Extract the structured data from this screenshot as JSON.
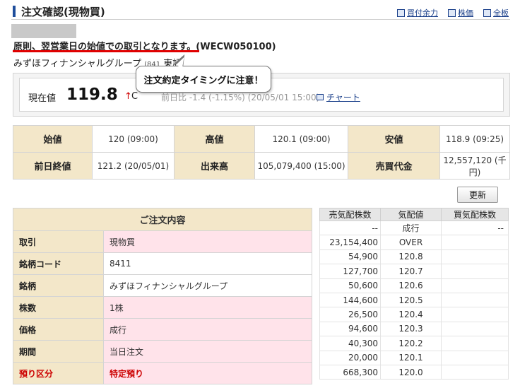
{
  "header": {
    "title": "注文確認(現物買)",
    "links": [
      "買付余力",
      "株価",
      "全板"
    ]
  },
  "notice": "原則、翌営業日の始値での取引となります。(WECW050100)",
  "stock": {
    "name": "みずほフィナンシャルグループ",
    "code_partial": "(841",
    "market": "東証"
  },
  "callout": "注文約定タイミングに注意！",
  "price_panel": {
    "label": "現在値",
    "value": "119.8",
    "arrow": "↑",
    "flag": "C",
    "prev_close_partial": "前日比 -1.4 (-1.15%)  (20/05/01 15:00)",
    "chart_link": "チャート"
  },
  "quote": {
    "rows": [
      [
        {
          "label": "始値",
          "value": "120 (09:00)"
        },
        {
          "label": "高値",
          "value": "120.1 (09:00)"
        },
        {
          "label": "安値",
          "value": "118.9 (09:25)"
        }
      ],
      [
        {
          "label": "前日終値",
          "value": "121.2 (20/05/01)"
        },
        {
          "label": "出来高",
          "value": "105,079,400 (15:00)"
        },
        {
          "label": "売買代金",
          "value": "12,557,120 (千円)"
        }
      ]
    ]
  },
  "refresh_label": "更新",
  "order": {
    "header": "ご注文内容",
    "rows": [
      {
        "label": "取引",
        "value": "現物買"
      },
      {
        "label": "銘柄コード",
        "value": "8411"
      },
      {
        "label": "銘柄",
        "value": "みずほフィナンシャルグループ"
      },
      {
        "label": "株数",
        "value": "1株"
      },
      {
        "label": "価格",
        "value": "成行"
      },
      {
        "label": "期間",
        "value": "当日注文"
      },
      {
        "label": "預り区分",
        "value": "特定預り"
      }
    ]
  },
  "board": {
    "headers": [
      "売気配株数",
      "気配値",
      "買気配株数"
    ],
    "rows": [
      {
        "sell": "--",
        "price": "成行",
        "buy": "--"
      },
      {
        "sell": "23,154,400",
        "price": "OVER",
        "buy": ""
      },
      {
        "sell": "54,900",
        "price": "120.8",
        "buy": ""
      },
      {
        "sell": "127,700",
        "price": "120.7",
        "buy": ""
      },
      {
        "sell": "50,600",
        "price": "120.6",
        "buy": ""
      },
      {
        "sell": "144,600",
        "price": "120.5",
        "buy": ""
      },
      {
        "sell": "26,500",
        "price": "120.4",
        "buy": ""
      },
      {
        "sell": "94,600",
        "price": "120.3",
        "buy": ""
      },
      {
        "sell": "40,300",
        "price": "120.2",
        "buy": ""
      },
      {
        "sell": "20,000",
        "price": "120.1",
        "buy": ""
      },
      {
        "sell": "668,300",
        "price": "120.0",
        "buy": ""
      }
    ]
  }
}
